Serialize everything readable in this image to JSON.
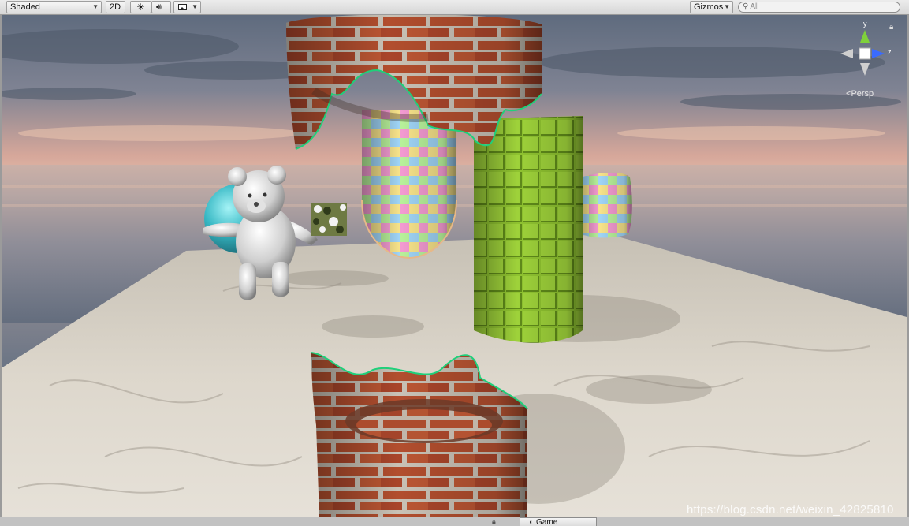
{
  "toolbar": {
    "shading_mode": "Shaded",
    "mode_2d": "2D",
    "lighting_icon": "sun-icon",
    "audio_icon": "speaker-icon",
    "effects_icon": "image-icon",
    "gizmos_label": "Gizmos",
    "search_placeholder": "All",
    "search_icon": "magnifier-icon"
  },
  "scene_gizmo": {
    "axis_y": "y",
    "axis_z": "z",
    "projection": "Persp",
    "colors": {
      "y": "#7fd13b",
      "z": "#3a6bff",
      "x": "#c8c8c8"
    }
  },
  "bottom": {
    "game_tab_label": "Game",
    "game_tab_icon": "pacman-icon",
    "lock_icon": "lock-icon"
  },
  "watermark": "https://blog.csdn.net/weixin_42825810",
  "scene_objects": [
    "brick-cylinder-top",
    "brick-cylinder-bottom",
    "checker-capsule",
    "green-cylinder",
    "checker-barrel",
    "teddy-bear",
    "cyan-sphere",
    "camo-cube",
    "sand-plane",
    "skybox"
  ]
}
